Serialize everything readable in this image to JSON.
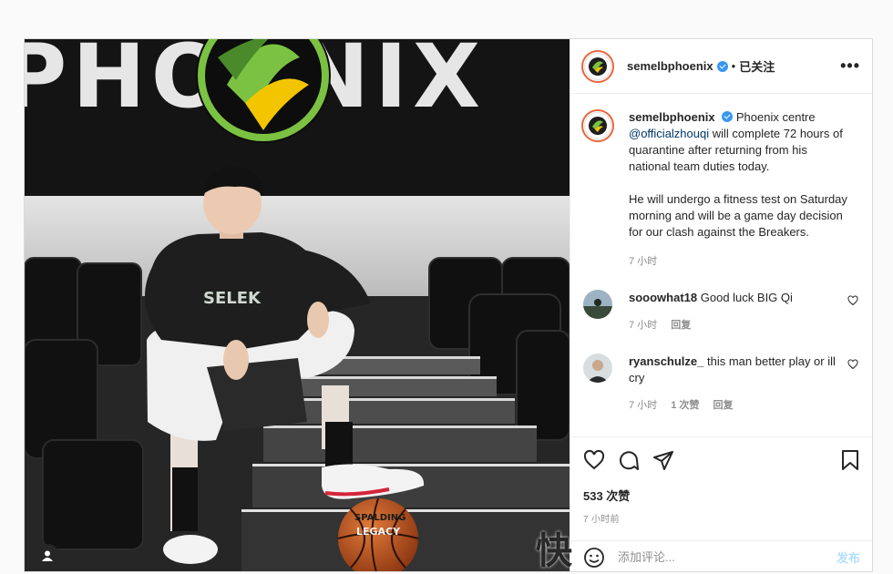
{
  "post": {
    "username": "semelbphoenix",
    "follow_status": "已关注",
    "more_label": "•••",
    "separator": "•",
    "caption": {
      "username": "semelbphoenix",
      "text_before_mention": "Phoenix centre",
      "mention": "@officialzhouqi",
      "text_after_mention": "will complete 72 hours of quarantine after returning from his national team duties today.",
      "paragraph2": "He will undergo a fitness test on Saturday morning and will be a game day decision for our clash against the Breakers.",
      "time": "7 小时"
    },
    "comments": [
      {
        "username": "sooowhat18",
        "text": "Good luck BIG Qi",
        "time": "7 小时",
        "reply_label": "回复"
      },
      {
        "username": "ryanschulze_",
        "text": "this man better play or ill cry",
        "time": "7 小时",
        "likes": "1 次赞",
        "reply_label": "回复"
      }
    ],
    "likes": "533 次赞",
    "posted_ago": "7 小时前",
    "comment_input_placeholder": "添加评论...",
    "post_button": "发布"
  },
  "photo": {
    "banner_text": "PHOENIX",
    "ball_brand": "SPALDING",
    "ball_model": "LEGACY"
  },
  "watermark": "快",
  "icons": {
    "profile_tag": "user-icon",
    "like": "heart-icon",
    "comment": "comment-icon",
    "share": "paper-plane-icon",
    "save": "bookmark-icon",
    "emoji": "emoji-icon"
  },
  "colors": {
    "verified": "#3897f0",
    "ring": "#e6683c",
    "phoenix_green": "#7cc242",
    "phoenix_yellow": "#f2c500",
    "ball": "#c8561c"
  }
}
